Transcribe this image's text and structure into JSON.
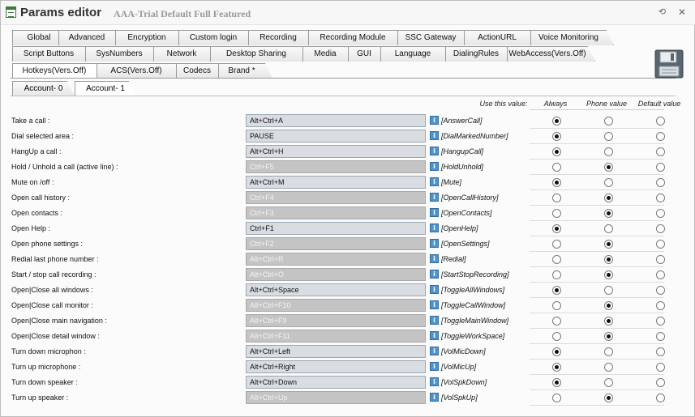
{
  "window": {
    "title": "Params editor",
    "subtitle": "AAA-Trial Default Full Featured",
    "icons": {
      "app": "form-icon",
      "refresh": "refresh-icon",
      "close": "close-icon",
      "save": "floppy-disk-icon"
    }
  },
  "tabs": {
    "row1": [
      "Global",
      "Advanced",
      "Encryption",
      "Custom login",
      "Recording",
      "Recording Module",
      "SSC Gateway",
      "ActionURL",
      "Voice Monitoring"
    ],
    "row2": [
      "Script Buttons",
      "SysNumbers",
      "Network",
      "Desktop Sharing",
      "Media",
      "GUI",
      "Language",
      "DialingRules",
      "WebAccess(Vers.Off)"
    ],
    "row3": [
      "Hotkeys(Vers.Off)",
      "ACS(Vers.Off)",
      "Codecs",
      "Brand *"
    ],
    "active": "Hotkeys(Vers.Off)"
  },
  "subtabs": [
    "Account- 0",
    "Account- 1"
  ],
  "columns": {
    "use_value": "Use this value:",
    "always": "Always",
    "phone": "Phone value",
    "default": "Default value"
  },
  "rows": [
    {
      "label": "Take a call :",
      "value": "Alt+Ctrl+A",
      "disabled": false,
      "key": "[AnswerCall]",
      "choice": "always"
    },
    {
      "label": "Dial selected area :",
      "value": "PAUSE",
      "disabled": false,
      "key": "[DialMarkedNumber]",
      "choice": "always"
    },
    {
      "label": "HangUp a call :",
      "value": "Alt+Ctrl+H",
      "disabled": false,
      "key": "[HangupCall]",
      "choice": "always"
    },
    {
      "label": "Hold / Unhold a call  (active line) :",
      "value": "Ctrl+F5",
      "disabled": true,
      "key": "[HoldUnhold]",
      "choice": "phone"
    },
    {
      "label": "Mute on /off :",
      "value": "Alt+Ctrl+M",
      "disabled": false,
      "key": "[Mute]",
      "choice": "always"
    },
    {
      "label": "Open call history :",
      "value": "Ctrl+F4",
      "disabled": true,
      "key": "[OpenCallHistory]",
      "choice": "phone"
    },
    {
      "label": "Open contacts :",
      "value": "Ctrl+F3",
      "disabled": true,
      "key": "[OpenContacts]",
      "choice": "phone"
    },
    {
      "label": "Open Help :",
      "value": "Ctrl+F1",
      "disabled": false,
      "key": "[OpenHelp]",
      "choice": "always"
    },
    {
      "label": "Open phone settings :",
      "value": "Ctrl+F2",
      "disabled": true,
      "key": "[OpenSettings]",
      "choice": "phone"
    },
    {
      "label": "Redial last phone number :",
      "value": "Alt+Ctrl+R",
      "disabled": true,
      "key": "[Redial]",
      "choice": "phone"
    },
    {
      "label": "Start / stop call recording :",
      "value": "Alt+Ctrl+O",
      "disabled": true,
      "key": "[StartStopRecording]",
      "choice": "phone"
    },
    {
      "label": "Open|Close all windows :",
      "value": "Alt+Ctrl+Space",
      "disabled": false,
      "key": "[ToggleAllWindows]",
      "choice": "always"
    },
    {
      "label": "Open|Close call monitor :",
      "value": "Alt+Ctrl+F10",
      "disabled": true,
      "key": "[ToggleCallWindow]",
      "choice": "phone"
    },
    {
      "label": "Open|Close main navigation :",
      "value": "Alt+Ctrl+F9",
      "disabled": true,
      "key": "[ToggleMainWindow]",
      "choice": "phone"
    },
    {
      "label": "Open|Close detail window :",
      "value": "Alt+Ctrl+F11",
      "disabled": true,
      "key": "[ToggleWorkSpace]",
      "choice": "phone"
    },
    {
      "label": "Turn down microphon :",
      "value": "Alt+Ctrl+Left",
      "disabled": false,
      "key": "[VolMicDown]",
      "choice": "always"
    },
    {
      "label": "Turn up microphone :",
      "value": "Alt+Ctrl+Right",
      "disabled": false,
      "key": "[VolMicUp]",
      "choice": "always"
    },
    {
      "label": "Turn down speaker :",
      "value": "Alt+Ctrl+Down",
      "disabled": false,
      "key": "[VolSpkDown]",
      "choice": "always"
    },
    {
      "label": "Turn up speaker :",
      "value": "Alt+Ctrl+Up",
      "disabled": true,
      "key": "[VolSpkUp]",
      "choice": "phone"
    }
  ]
}
